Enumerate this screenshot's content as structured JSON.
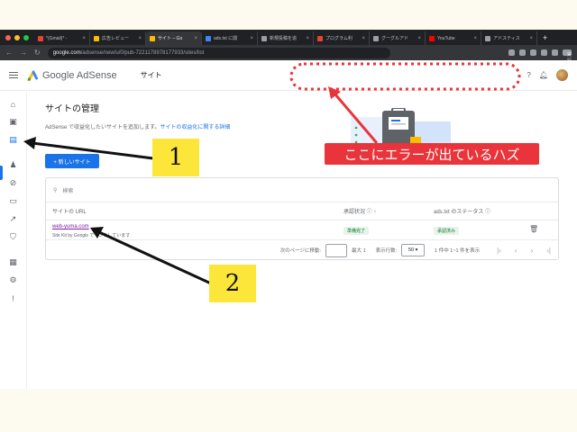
{
  "browser": {
    "tabs": [
      {
        "title": "*(Gmail)* -",
        "color": "#ea4335"
      },
      {
        "title": "広告レビュー",
        "color": "#fbbc04"
      },
      {
        "title": "サイト – Go",
        "color": "#fbbc04"
      },
      {
        "title": "ads.txt に関",
        "color": "#4285f4"
      },
      {
        "title": "新規投稿を追",
        "color": "#9aa0a6"
      },
      {
        "title": "プログラム利",
        "color": "#ea4335"
      },
      {
        "title": "グーグルアド",
        "color": "#9aa0a6"
      },
      {
        "title": "YouTube",
        "color": "#ff0000"
      },
      {
        "title": "アドスティス",
        "color": "#9aa0a6"
      }
    ],
    "new_tab": "+",
    "url_host": "google.com",
    "url_path": "/adsense/new/u/0/pub-7221178978177933/sites/list",
    "resume_label": "実行を完了 :"
  },
  "header": {
    "brand": "Google AdSense",
    "section": "サイト"
  },
  "main": {
    "title": "サイトの管理",
    "subtitle": "AdSense で収益化したいサイトを追加します。",
    "link": "サイトの収益化に関する詳細",
    "new_site_button": "+ 新しいサイト"
  },
  "table": {
    "search_placeholder": "検索",
    "columns": [
      "サイトの URL",
      "承認状況 ⓘ ↑",
      "ads.txt のステータス ⓘ"
    ],
    "rows": [
      {
        "url": "web-yuma.com",
        "kit": "Site Kit by Google でリンクしています",
        "approval": "準備完了",
        "ads_txt": "承認済み"
      }
    ]
  },
  "pagination": {
    "goto_label": "次のページに移動:",
    "max_label": "最大 1",
    "per_page_label": "表示行数:",
    "per_page_value": "50",
    "range_label": "1 件中 1~1 件を表示"
  },
  "annotations": {
    "label_1": "1",
    "label_2": "2",
    "error_text": "ここにエラーが出ているハズ"
  }
}
